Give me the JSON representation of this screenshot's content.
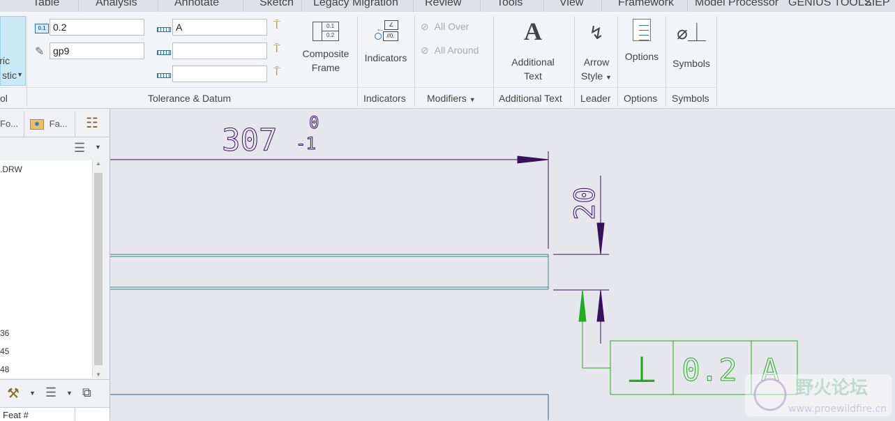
{
  "tabs": [
    "Table",
    "Analysis",
    "Annotate",
    "Sketch",
    "Legacy Migration",
    "Review",
    "Tools",
    "View",
    "Framework",
    "Model Processor",
    "GENIUS TOOLS",
    "ZIEP"
  ],
  "ribbon": {
    "left_fragment": {
      "line1": "ric",
      "line2": "stic",
      "group": "ol"
    },
    "tolerance_value": "0.2",
    "fit_value": "gp9",
    "datum_primary": "A",
    "datum_secondary": "",
    "datum_tertiary": "",
    "composite_frame": {
      "line1": "Composite",
      "line2": "Frame"
    },
    "tolerance_group": "Tolerance & Datum",
    "indicators_btn": "Indicators",
    "indicators_group": "Indicators",
    "all_over": "All Over",
    "all_around": "All Around",
    "modifiers_group": "Modifiers",
    "additional_text": {
      "line1": "Additional",
      "line2": "Text"
    },
    "additional_text_group": "Additional Text",
    "arrow_style": {
      "line1": "Arrow",
      "line2": "Style"
    },
    "leader_group": "Leader",
    "options_btn": "Options",
    "options_group": "Options",
    "symbols_btn": "Symbols",
    "symbols_group": "Symbols"
  },
  "left_panel": {
    "tab1": "Fo...",
    "tab2": "Fa...",
    "tree_items": [
      ".DRW",
      "36",
      "45",
      "48"
    ],
    "column_header": "Feat #"
  },
  "drawing": {
    "dim_horizontal": "307",
    "tol_upper": "0",
    "tol_lower": "-1",
    "dim_vertical": "20",
    "gtol_symbol": "⊥",
    "gtol_value": "0.2",
    "gtol_datum": "A"
  },
  "watermark": {
    "title": "野火论坛",
    "url": "www.proewildfire.cn"
  },
  "colors": {
    "dimension": "#3a0f5e",
    "gtol": "#1fae1f",
    "part_edge": "#2e8b8b",
    "watermark": "#b9d9c8"
  }
}
